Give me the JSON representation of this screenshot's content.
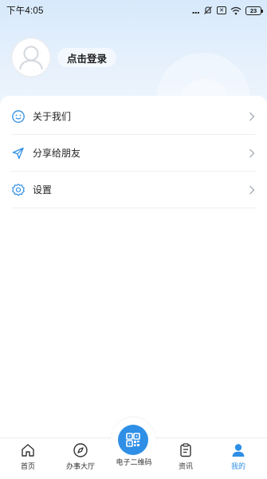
{
  "status_bar": {
    "time": "下午4:05",
    "dots": "...",
    "battery": "23"
  },
  "profile": {
    "login_label": "点击登录"
  },
  "menu": {
    "items": [
      {
        "label": "关于我们",
        "icon": "smile-icon"
      },
      {
        "label": "分享给朋友",
        "icon": "send-icon"
      },
      {
        "label": "设置",
        "icon": "gear-icon"
      }
    ]
  },
  "bottom_nav": {
    "items": [
      {
        "label": "首页",
        "icon": "home-icon"
      },
      {
        "label": "办事大厅",
        "icon": "compass-icon"
      },
      {
        "label": "电子二维码",
        "icon": "qr-code-icon"
      },
      {
        "label": "资讯",
        "icon": "clipboard-icon"
      },
      {
        "label": "我的",
        "icon": "user-icon"
      }
    ],
    "active": "我的"
  },
  "colors": {
    "accent": "#2f8fe6",
    "header_top": "#d7e9fb",
    "text": "#222222"
  }
}
